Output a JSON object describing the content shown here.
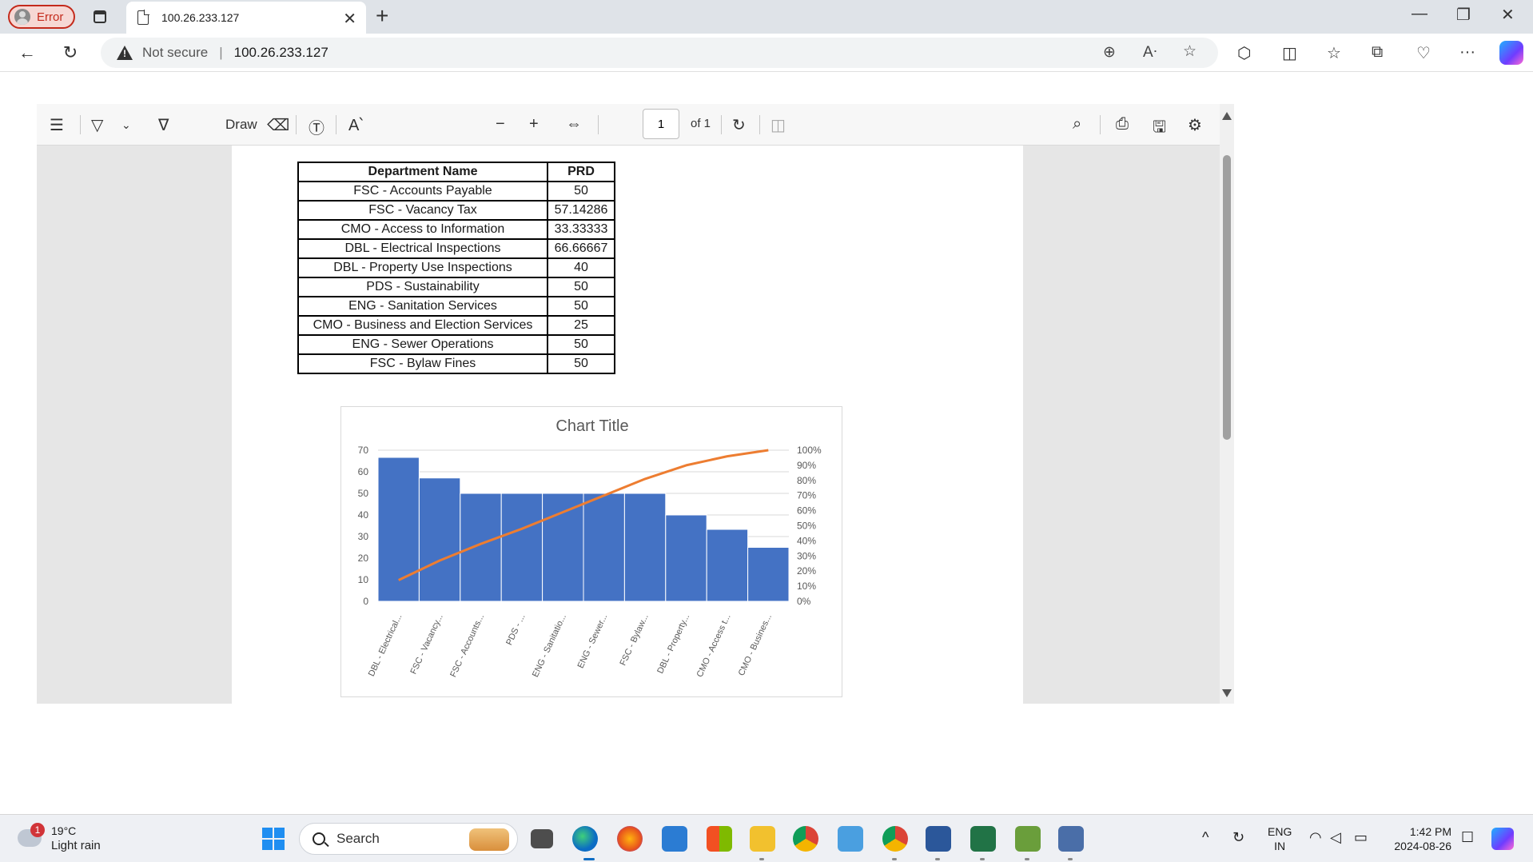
{
  "browser": {
    "profile_label": "Error",
    "tab_title": "100.26.233.127",
    "not_secure": "Not secure",
    "url": "100.26.233.127"
  },
  "pdf_toolbar": {
    "draw_label": "Draw",
    "page_value": "1",
    "page_of": "of 1"
  },
  "table": {
    "headers": [
      "Department Name",
      "PRD"
    ],
    "rows": [
      [
        "FSC - Accounts Payable",
        "50"
      ],
      [
        "FSC - Vacancy Tax",
        "57.14286"
      ],
      [
        "CMO - Access to Information",
        "33.33333"
      ],
      [
        "DBL - Electrical Inspections",
        "66.66667"
      ],
      [
        "DBL - Property Use Inspections",
        "40"
      ],
      [
        "PDS - Sustainability",
        "50"
      ],
      [
        "ENG - Sanitation Services",
        "50"
      ],
      [
        "CMO - Business and Election Services",
        "25"
      ],
      [
        "ENG - Sewer Operations",
        "50"
      ],
      [
        "FSC - Bylaw Fines",
        "50"
      ]
    ]
  },
  "chart_data": {
    "type": "bar",
    "title": "Chart Title",
    "categories": [
      "DBL - Electrical...",
      "FSC - Vacancy...",
      "FSC - Accounts...",
      "PDS - ...",
      "ENG - Sanitatio...",
      "ENG - Sewer...",
      "FSC - Bylaw...",
      "DBL - Property...",
      "CMO - Access t...",
      "CMO - Busines..."
    ],
    "series": [
      {
        "values": [
          66.67,
          57.14,
          50,
          50,
          50,
          50,
          50,
          40,
          33.33,
          25
        ],
        "type": "bar",
        "color": "#4472c4"
      },
      {
        "values": [
          14,
          27,
          38,
          48,
          59,
          70,
          81,
          90,
          96,
          100
        ],
        "type": "line",
        "axis": "right",
        "color": "#ed7d31"
      }
    ],
    "y_ticks": [
      "0",
      "10",
      "20",
      "30",
      "40",
      "50",
      "60",
      "70"
    ],
    "y2_ticks": [
      "0%",
      "10%",
      "20%",
      "30%",
      "40%",
      "50%",
      "60%",
      "70%",
      "80%",
      "90%",
      "100%"
    ],
    "ylim": [
      0,
      70
    ],
    "y2lim": [
      0,
      100
    ],
    "grid": true
  },
  "taskbar": {
    "weather_badge": "1",
    "temperature": "19°C",
    "condition": "Light rain",
    "search_placeholder": "Search",
    "lang_top": "ENG",
    "lang_bottom": "IN",
    "time": "1:42 PM",
    "date": "2024-08-26"
  }
}
